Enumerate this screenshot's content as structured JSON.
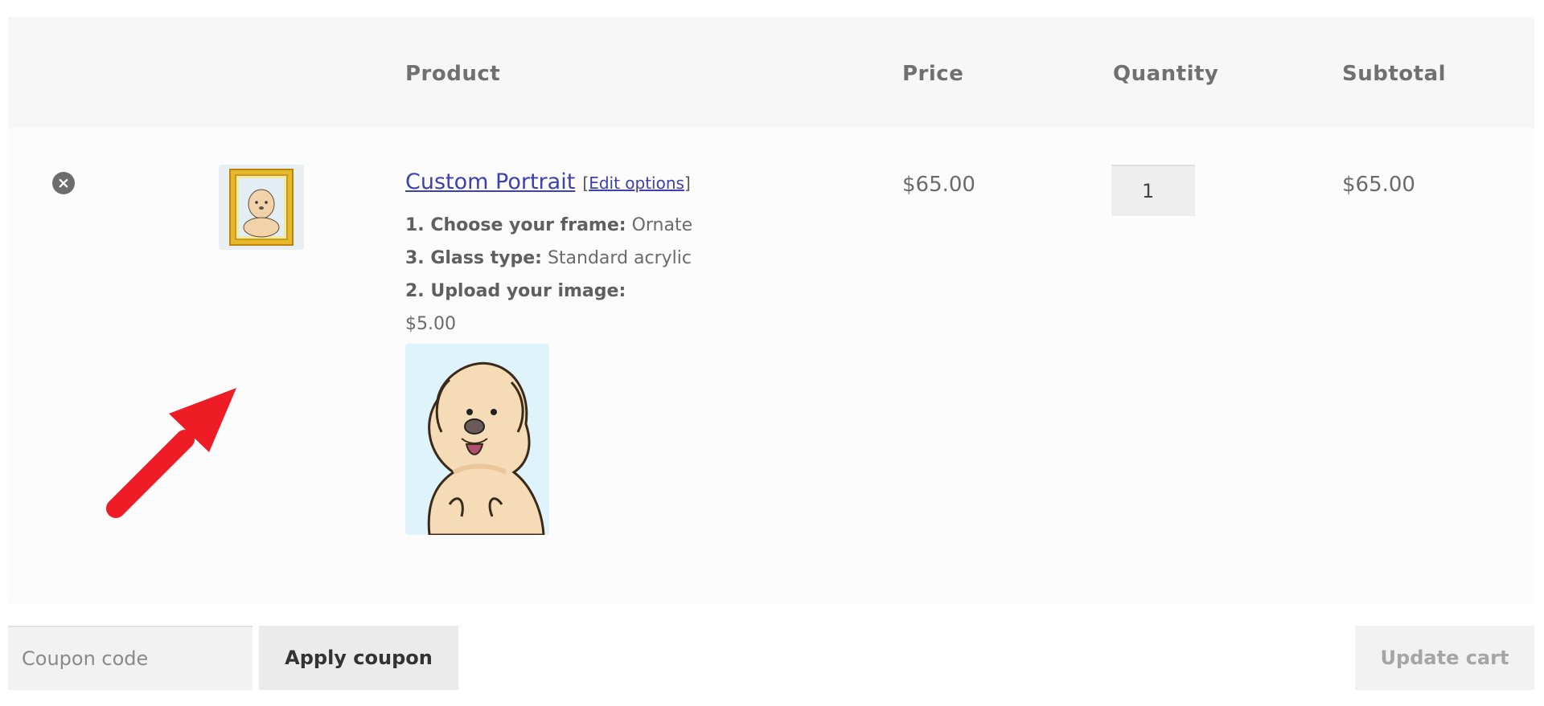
{
  "table": {
    "headers": {
      "product": "Product",
      "price": "Price",
      "quantity": "Quantity",
      "subtotal": "Subtotal"
    }
  },
  "item": {
    "remove_icon": "×",
    "product_name": "Custom Portrait",
    "edit_open": "[",
    "edit_label": "Edit options",
    "edit_close": "]",
    "options": [
      {
        "label": "1. Choose your frame:",
        "value": "Ornate"
      },
      {
        "label": "3. Glass type:",
        "value": "Standard acrylic"
      },
      {
        "label": "2. Upload your image:",
        "value": ""
      }
    ],
    "upload_price": "$5.00",
    "price": "$65.00",
    "quantity": "1",
    "subtotal": "$65.00"
  },
  "actions": {
    "coupon_placeholder": "Coupon code",
    "apply_label": "Apply coupon",
    "update_label": "Update cart"
  },
  "colors": {
    "link": "#3f3fb0",
    "arrow": "#ee1c25"
  }
}
